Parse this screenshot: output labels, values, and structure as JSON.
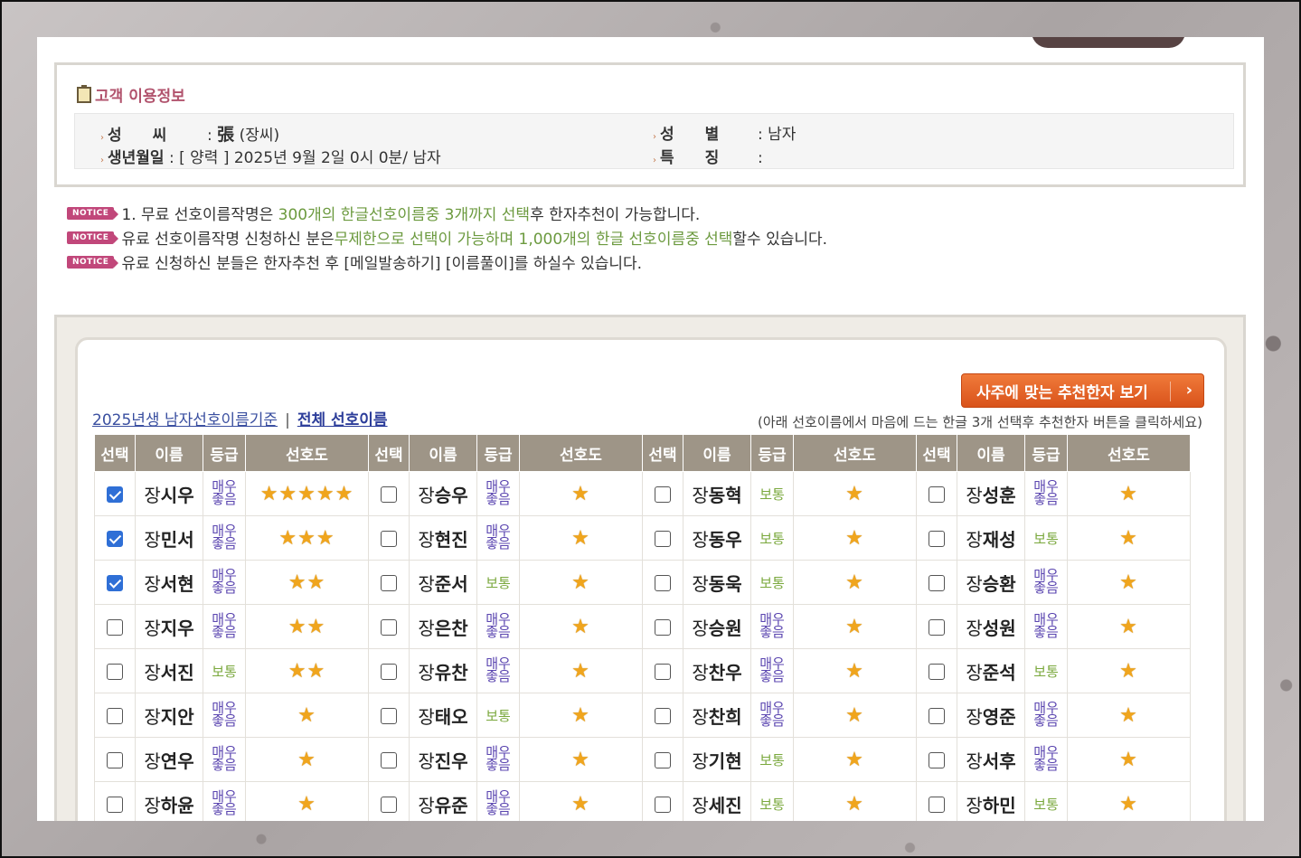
{
  "info": {
    "title": "고객 이용정보",
    "surname_label": "성　　씨",
    "surname_han": "張",
    "surname_val": "(장씨)",
    "birth_label": "생년월일",
    "birth_val": ": [ 양력 ] 2025년 9월 2일 0시 0분/ 남자",
    "gender_label": "성　　별",
    "gender_val": ": 남자",
    "feature_label": "특　　징",
    "feature_val": ":"
  },
  "notice_badge": "NOTICE",
  "notices": [
    {
      "a": "1. 무료 선호이름작명은 ",
      "h1": "300개의 한글선호이름중 3개까지 선택",
      "b": "후 한자추천이 가능합니다."
    },
    {
      "a": "유료 선호이름작명 신청하신 분은",
      "h1": "무제한으로 선택이 가능하며 1,000개의 한글 선호이름중 선택",
      "b": "할수 있습니다."
    },
    {
      "a": "유료 신청하신 분들은 한자추천 후 [메일발송하기] [이름풀이]를 하실수 있습니다.",
      "h1": "",
      "b": ""
    }
  ],
  "list": {
    "rec_button": "사주에 맞는 추천한자 보기",
    "link_year": "2025년생 남자선호이름기준",
    "link_sep": "|",
    "link_all": "전체 선호이름",
    "guide": "(아래 선호이름에서 마음에 드는 한글 3개 선택후 추천한자 버튼을 클릭하세요)",
    "headers": [
      "선택",
      "이름",
      "등급",
      "선호도"
    ]
  },
  "rows": [
    [
      {
        "s": "장",
        "g": "시우",
        "grade": "매우좋음",
        "good": true,
        "stars": 5,
        "checked": true
      },
      {
        "s": "장",
        "g": "승우",
        "grade": "매우좋음",
        "good": true,
        "stars": 1,
        "checked": false
      },
      {
        "s": "장",
        "g": "동혁",
        "grade": "보통",
        "good": false,
        "stars": 1,
        "checked": false
      },
      {
        "s": "장",
        "g": "성훈",
        "grade": "매우좋음",
        "good": true,
        "stars": 1,
        "checked": false
      }
    ],
    [
      {
        "s": "장",
        "g": "민서",
        "grade": "매우좋음",
        "good": true,
        "stars": 3,
        "checked": true
      },
      {
        "s": "장",
        "g": "현진",
        "grade": "매우좋음",
        "good": true,
        "stars": 1,
        "checked": false
      },
      {
        "s": "장",
        "g": "동우",
        "grade": "보통",
        "good": false,
        "stars": 1,
        "checked": false
      },
      {
        "s": "장",
        "g": "재성",
        "grade": "보통",
        "good": false,
        "stars": 1,
        "checked": false
      }
    ],
    [
      {
        "s": "장",
        "g": "서현",
        "grade": "매우좋음",
        "good": true,
        "stars": 2,
        "checked": true
      },
      {
        "s": "장",
        "g": "준서",
        "grade": "보통",
        "good": false,
        "stars": 1,
        "checked": false
      },
      {
        "s": "장",
        "g": "동욱",
        "grade": "보통",
        "good": false,
        "stars": 1,
        "checked": false
      },
      {
        "s": "장",
        "g": "승환",
        "grade": "매우좋음",
        "good": true,
        "stars": 1,
        "checked": false
      }
    ],
    [
      {
        "s": "장",
        "g": "지우",
        "grade": "매우좋음",
        "good": true,
        "stars": 2,
        "checked": false
      },
      {
        "s": "장",
        "g": "은찬",
        "grade": "매우좋음",
        "good": true,
        "stars": 1,
        "checked": false
      },
      {
        "s": "장",
        "g": "승원",
        "grade": "매우좋음",
        "good": true,
        "stars": 1,
        "checked": false
      },
      {
        "s": "장",
        "g": "성원",
        "grade": "매우좋음",
        "good": true,
        "stars": 1,
        "checked": false
      }
    ],
    [
      {
        "s": "장",
        "g": "서진",
        "grade": "보통",
        "good": false,
        "stars": 2,
        "checked": false
      },
      {
        "s": "장",
        "g": "유찬",
        "grade": "매우좋음",
        "good": true,
        "stars": 1,
        "checked": false
      },
      {
        "s": "장",
        "g": "찬우",
        "grade": "매우좋음",
        "good": true,
        "stars": 1,
        "checked": false
      },
      {
        "s": "장",
        "g": "준석",
        "grade": "보통",
        "good": false,
        "stars": 1,
        "checked": false
      }
    ],
    [
      {
        "s": "장",
        "g": "지안",
        "grade": "매우좋음",
        "good": true,
        "stars": 1,
        "checked": false
      },
      {
        "s": "장",
        "g": "태오",
        "grade": "보통",
        "good": false,
        "stars": 1,
        "checked": false
      },
      {
        "s": "장",
        "g": "찬희",
        "grade": "매우좋음",
        "good": true,
        "stars": 1,
        "checked": false
      },
      {
        "s": "장",
        "g": "영준",
        "grade": "매우좋음",
        "good": true,
        "stars": 1,
        "checked": false
      }
    ],
    [
      {
        "s": "장",
        "g": "연우",
        "grade": "매우좋음",
        "good": true,
        "stars": 1,
        "checked": false
      },
      {
        "s": "장",
        "g": "진우",
        "grade": "매우좋음",
        "good": true,
        "stars": 1,
        "checked": false
      },
      {
        "s": "장",
        "g": "기현",
        "grade": "보통",
        "good": false,
        "stars": 1,
        "checked": false
      },
      {
        "s": "장",
        "g": "서후",
        "grade": "매우좋음",
        "good": true,
        "stars": 1,
        "checked": false
      }
    ],
    [
      {
        "s": "장",
        "g": "하윤",
        "grade": "매우좋음",
        "good": true,
        "stars": 1,
        "checked": false
      },
      {
        "s": "장",
        "g": "유준",
        "grade": "매우좋음",
        "good": true,
        "stars": 1,
        "checked": false
      },
      {
        "s": "장",
        "g": "세진",
        "grade": "보통",
        "good": false,
        "stars": 1,
        "checked": false
      },
      {
        "s": "장",
        "g": "하민",
        "grade": "보통",
        "good": false,
        "stars": 1,
        "checked": false
      }
    ]
  ],
  "colors": {
    "header_bg": "#9e9587",
    "good_grade": "#5b46b0",
    "normal_grade": "#7aa83d",
    "star": "#f0a51d",
    "button": "#e0622a",
    "title": "#b1536d"
  }
}
